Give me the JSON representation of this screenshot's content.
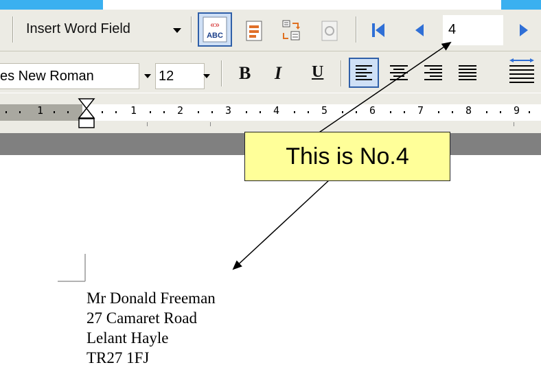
{
  "mail_merge_toolbar": {
    "insert_word_field_label": "Insert Word Field",
    "record_number": "4"
  },
  "formatting_toolbar": {
    "font_name": "es New Roman",
    "font_size": "12",
    "bold_label": "B",
    "italic_label": "I",
    "underline_label": "U"
  },
  "ruler": {
    "labels": [
      "1",
      "1",
      "2",
      "3",
      "4",
      "5",
      "6",
      "7",
      "8",
      "9"
    ]
  },
  "callout": {
    "text": "This is No.4"
  },
  "document": {
    "address_lines": [
      "Mr Donald Freeman",
      "27 Camaret Road",
      "Lelant Hayle",
      "TR27 1FJ"
    ]
  },
  "colors": {
    "toolbar_bg": "#ecebe4",
    "callout_bg": "#ffff99",
    "accent_blue": "#3ab0f0",
    "nav_blue": "#2f6fd6"
  },
  "icons": [
    "view-merged-data-icon",
    "highlight-merge-fields-icon",
    "match-fields-icon",
    "propagate-labels-icon",
    "first-record-icon",
    "previous-record-icon",
    "next-record-icon",
    "align-left-icon",
    "center-icon",
    "align-right-icon",
    "justify-icon",
    "distributed-icon",
    "dropdown-arrow-icon"
  ]
}
